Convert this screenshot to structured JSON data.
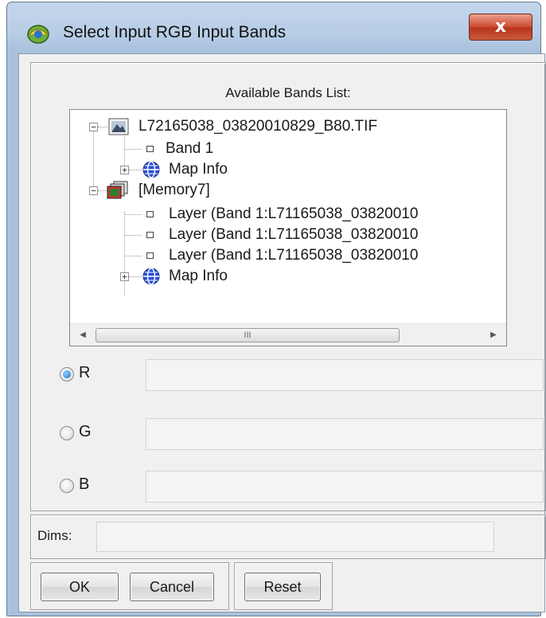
{
  "window": {
    "title": "Select Input RGB Input Bands",
    "close_label": "x"
  },
  "bands": {
    "header": "Available Bands List:",
    "nodes": [
      {
        "label": "L72165038_03820010829_B80.TIF",
        "icon": "raster-file-icon",
        "expander": "−"
      },
      {
        "label": "Band 1",
        "icon": "band-leaf-icon"
      },
      {
        "label": "Map Info",
        "icon": "globe-icon",
        "expander": "+"
      },
      {
        "label": "[Memory7]",
        "icon": "memory-stack-icon",
        "expander": "−"
      },
      {
        "label": "Layer (Band 1:L71165038_03820010",
        "icon": "band-leaf-icon"
      },
      {
        "label": "Layer (Band 1:L71165038_03820010",
        "icon": "band-leaf-icon"
      },
      {
        "label": "Layer (Band 1:L71165038_03820010",
        "icon": "band-leaf-icon"
      },
      {
        "label": "Map Info",
        "icon": "globe-icon",
        "expander": "+"
      }
    ],
    "scroll_left": "◀",
    "scroll_right": "▶",
    "scroll_grip": "III"
  },
  "channels": {
    "selected": "R",
    "items": [
      {
        "label": "R",
        "value": ""
      },
      {
        "label": "G",
        "value": ""
      },
      {
        "label": "B",
        "value": ""
      }
    ]
  },
  "dims": {
    "label": "Dims:",
    "value": ""
  },
  "buttons": {
    "ok": "OK",
    "cancel": "Cancel",
    "reset": "Reset"
  }
}
